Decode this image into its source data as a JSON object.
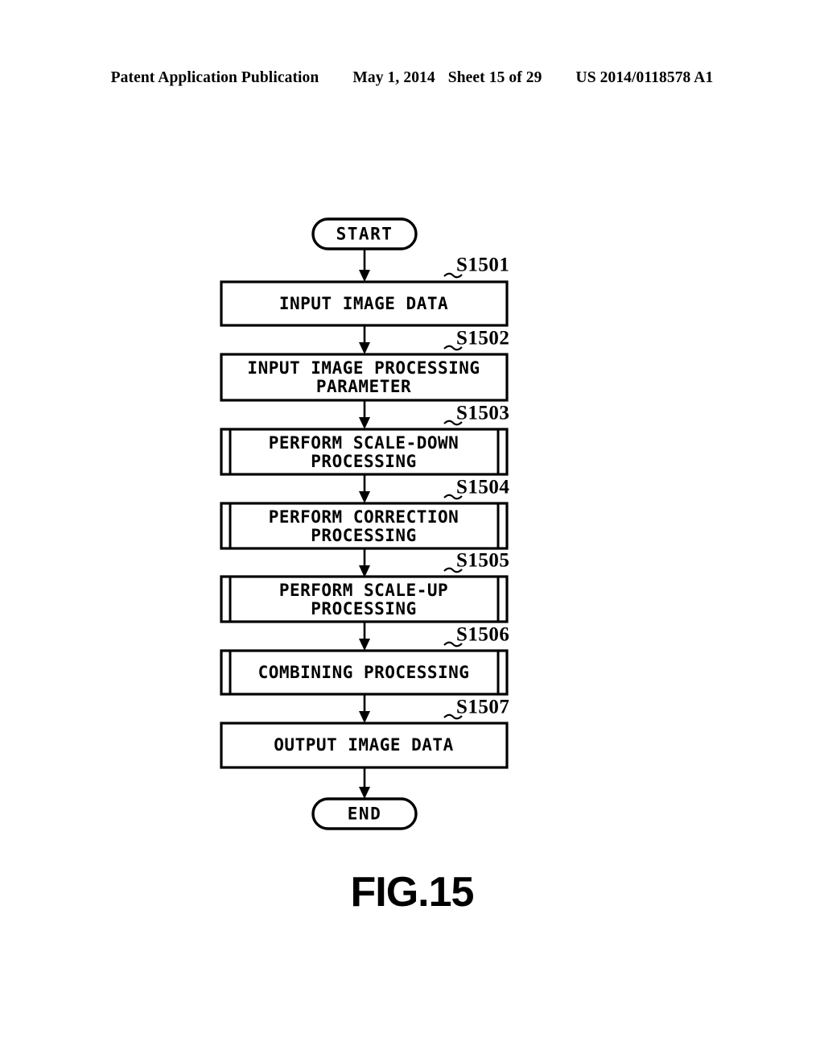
{
  "header": {
    "publication": "Patent Application Publication",
    "date": "May 1, 2014",
    "sheet": "Sheet 15 of 29",
    "patent_number": "US 2014/0118578 A1"
  },
  "figure": {
    "caption": "FIG.15",
    "type": "flowchart"
  },
  "flowchart": {
    "start_label": "START",
    "end_label": "END",
    "nodes": [
      {
        "id": "S1501",
        "step_label": "S1501",
        "text_lines": [
          "INPUT IMAGE DATA"
        ],
        "shape": "process"
      },
      {
        "id": "S1502",
        "step_label": "S1502",
        "text_lines": [
          "INPUT IMAGE PROCESSING",
          "PARAMETER"
        ],
        "shape": "process"
      },
      {
        "id": "S1503",
        "step_label": "S1503",
        "text_lines": [
          "PERFORM SCALE-DOWN",
          "PROCESSING"
        ],
        "shape": "subroutine"
      },
      {
        "id": "S1504",
        "step_label": "S1504",
        "text_lines": [
          "PERFORM CORRECTION",
          "PROCESSING"
        ],
        "shape": "subroutine"
      },
      {
        "id": "S1505",
        "step_label": "S1505",
        "text_lines": [
          "PERFORM SCALE-UP",
          "PROCESSING"
        ],
        "shape": "subroutine"
      },
      {
        "id": "S1506",
        "step_label": "S1506",
        "text_lines": [
          "COMBINING PROCESSING"
        ],
        "shape": "subroutine"
      },
      {
        "id": "S1507",
        "step_label": "S1507",
        "text_lines": [
          "OUTPUT IMAGE DATA"
        ],
        "shape": "process"
      }
    ]
  }
}
